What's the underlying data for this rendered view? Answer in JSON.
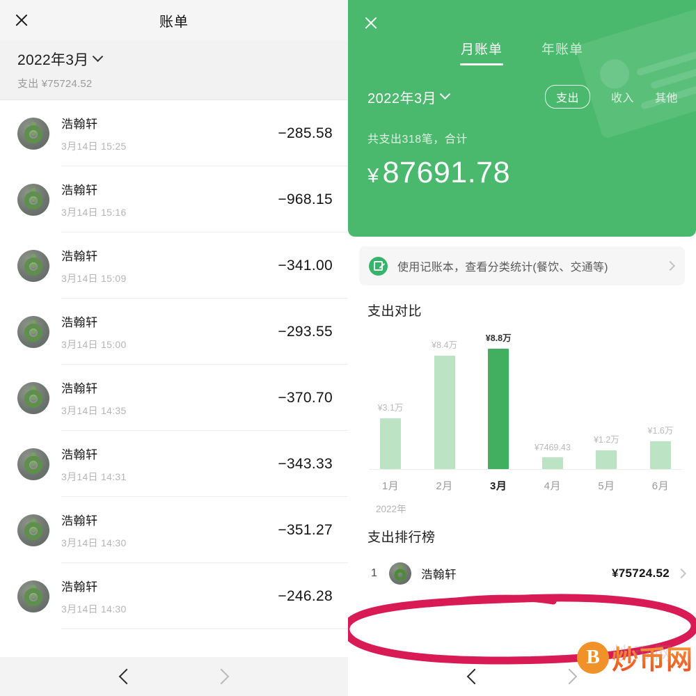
{
  "left": {
    "topbar": {
      "title": "账单",
      "close_icon": "close-icon"
    },
    "subheader": {
      "month": "2022年3月",
      "chevron_icon": "chevron-down-icon",
      "spend_label": "支出 ¥75724.52"
    },
    "transactions": [
      {
        "name": "浩翰轩",
        "time": "3月14日 15:25",
        "amount": "−285.58"
      },
      {
        "name": "浩翰轩",
        "time": "3月14日 15:16",
        "amount": "−968.15"
      },
      {
        "name": "浩翰轩",
        "time": "3月14日 15:09",
        "amount": "−341.00"
      },
      {
        "name": "浩翰轩",
        "time": "3月14日 15:00",
        "amount": "−293.55"
      },
      {
        "name": "浩翰轩",
        "time": "3月14日 14:35",
        "amount": "−370.70"
      },
      {
        "name": "浩翰轩",
        "time": "3月14日 14:31",
        "amount": "−343.33"
      },
      {
        "name": "浩翰轩",
        "time": "3月14日 14:30",
        "amount": "−351.27"
      },
      {
        "name": "浩翰轩",
        "time": "3月14日 14:30",
        "amount": "−246.28"
      }
    ],
    "navbar": {
      "back_icon": "chevron-left-icon",
      "forward_icon": "chevron-right-icon"
    }
  },
  "right": {
    "close_icon": "close-icon",
    "tabs": [
      {
        "label": "月账单",
        "active": true
      },
      {
        "label": "年账单",
        "active": false
      }
    ],
    "filters": {
      "month": "2022年3月",
      "chevron_icon": "chevron-down-icon",
      "pills": [
        {
          "label": "支出",
          "selected": true
        },
        {
          "label": "收入",
          "selected": false
        },
        {
          "label": "其他",
          "selected": false
        }
      ]
    },
    "summary": {
      "label": "共支出318笔，合计",
      "yen": "¥",
      "amount": "87691.78"
    },
    "banner": {
      "icon": "notebook-pen-icon",
      "text": "使用记账本，查看分类统计(餐饮、交通等)",
      "chevron_icon": "chevron-right-icon"
    },
    "compare_title": "支出对比",
    "rank_title": "支出排行榜",
    "rank_rows": [
      {
        "index": "1",
        "name": "浩翰轩",
        "amount": "¥75724.52",
        "chevron_icon": "chevron-right-icon"
      }
    ],
    "navbar": {
      "back_icon": "chevron-left-icon",
      "forward_icon": "chevron-right-icon"
    }
  },
  "annotation": {
    "shape": "hand-drawn-ellipse",
    "color": "#D81B54"
  },
  "watermark": {
    "coin_letter": "B",
    "text": "炒币网",
    "ghost_text": "炒币网",
    "color": "#F0912A"
  },
  "colors": {
    "brand_green": "#4AB96D",
    "bar_light": "#BBE3C4",
    "bar_highlight": "#41AE60",
    "annotation_pink": "#D81B54",
    "watermark_orange": "#F0912A"
  },
  "chart_data": {
    "type": "bar",
    "title": "支出对比",
    "categories": [
      "1月",
      "2月",
      "3月",
      "4月",
      "5月",
      "6月"
    ],
    "value_labels": [
      "¥3.1万",
      "¥8.4万",
      "¥8.8万",
      "¥7469.43",
      "¥1.2万",
      "¥1.6万"
    ],
    "values": [
      31000,
      84000,
      88000,
      7469.43,
      12000,
      16000
    ],
    "highlight_index": 2,
    "xlabel": "2022年",
    "ylabel": "",
    "ylim": [
      0,
      88000
    ],
    "grid": false,
    "legend": "none",
    "bar_heights_pct": [
      35,
      95,
      100,
      8,
      14,
      18
    ]
  }
}
